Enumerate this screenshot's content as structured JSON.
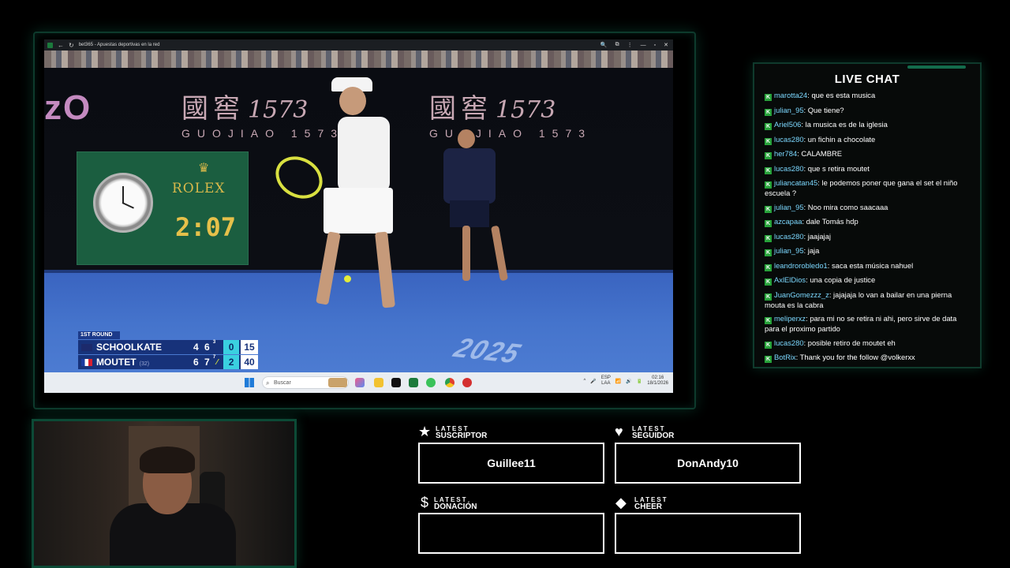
{
  "browser": {
    "tab_title": "bet365 - Apuestas deportivas en la red",
    "back_glyph": "←",
    "reload_glyph": "↻",
    "controls": [
      "🔍",
      "⧉",
      "⋮",
      "—",
      "▫",
      "✕"
    ]
  },
  "broadcast": {
    "sponsor_hanzi": "國窖",
    "sponsor_number": "1573",
    "sponsor_latin": "GUOJIAO 1573",
    "az_logo": "zO",
    "clock_brand": "ROLEX",
    "clock_time": "2:07",
    "court_text": "2025"
  },
  "scoreboard": {
    "round": "1ST ROUND",
    "players": [
      {
        "name": "SCHOOLKATE",
        "seed": "",
        "set1": "4",
        "set2": "6",
        "set2_tb": "3",
        "serving": false,
        "games": "0",
        "points": "15"
      },
      {
        "name": "MOUTET",
        "seed": "(32)",
        "set1": "6",
        "set2": "7",
        "set2_tb": "7",
        "serving": true,
        "games": "2",
        "points": "40"
      }
    ]
  },
  "taskbar": {
    "search_placeholder": "Buscar",
    "lang_top": "ESP",
    "lang_bottom": "LAA",
    "time": "02:16",
    "date": "18/1/2026",
    "tray_icons": [
      "^",
      "🎤",
      "📶",
      "🔊",
      "🔋"
    ]
  },
  "chat": {
    "title": "LIVE CHAT",
    "messages": [
      {
        "user": "marotta24",
        "text": "que es esta musica"
      },
      {
        "user": "julian_95",
        "text": "Que tiene?"
      },
      {
        "user": "Ariel506",
        "text": "la musica es de la iglesia"
      },
      {
        "user": "lucas280",
        "text": "un fichin a chocolate"
      },
      {
        "user": "her784",
        "text": "CALAMBRE"
      },
      {
        "user": "lucas280",
        "text": "que s retira moutet"
      },
      {
        "user": "juliancatan45",
        "text": "le podemos poner que gana el set el niño escuela ?"
      },
      {
        "user": "julian_95",
        "text": "Noo mira como saacaaa"
      },
      {
        "user": "azcapaa",
        "text": "dale Tomás hdp"
      },
      {
        "user": "lucas280",
        "text": "jaajajaj"
      },
      {
        "user": "julian_95",
        "text": "jaja"
      },
      {
        "user": "leandrorobledo1",
        "text": "saca esta música nahuel"
      },
      {
        "user": "AxlElDios",
        "text": "una copia de justice"
      },
      {
        "user": "JuanGomezzz_z",
        "text": "jajajaja lo van a bailar en una pierna mouta es la cabra"
      },
      {
        "user": "meliperxz",
        "text": "para mi no se retira ni ahi, pero sirve de data para el proximo partido"
      },
      {
        "user": "lucas280",
        "text": "posible retiro de moutet eh"
      },
      {
        "user": "BotRix",
        "text": "Thank you for the follow @volkerxx"
      }
    ]
  },
  "alerts": {
    "suscriptor": {
      "small": "LATEST",
      "big": "SUSCRIPTOR",
      "icon": "★",
      "value": "Guillee11"
    },
    "seguidor": {
      "small": "LATEST",
      "big": "SEGUIDOR",
      "icon": "♥",
      "value": "DonAndy10"
    },
    "donacion": {
      "small": "LATEST",
      "big": "DONACIÓN",
      "icon": "$",
      "value": ""
    },
    "cheer": {
      "small": "LATEST",
      "big": "CHEER",
      "icon": "◆",
      "value": ""
    }
  }
}
